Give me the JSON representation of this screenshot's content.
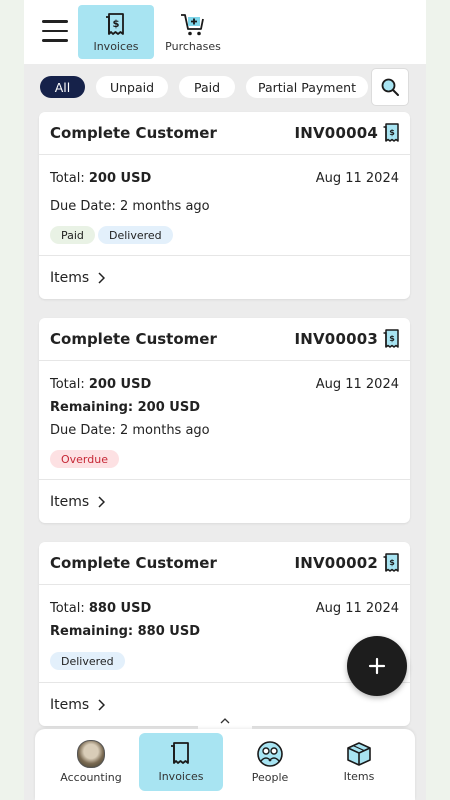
{
  "header": {
    "tabs": [
      {
        "label": "Invoices",
        "icon": "invoice-icon",
        "active": true
      },
      {
        "label": "Purchases",
        "icon": "cart-add-icon",
        "active": false
      }
    ]
  },
  "filters": {
    "chips": [
      "All",
      "Unpaid",
      "Paid",
      "Partial Payment"
    ],
    "active": "All",
    "search_icon": "search-icon"
  },
  "invoices": [
    {
      "customer": "Complete Customer",
      "number": "INV00004",
      "total_label": "Total:",
      "total": "200 USD",
      "date": "Aug 11 2024",
      "due": "Due Date: 2 months ago",
      "tags": [
        "Paid",
        "Delivered"
      ],
      "items_label": "Items"
    },
    {
      "customer": "Complete Customer",
      "number": "INV00003",
      "total_label": "Total:",
      "total": "200 USD",
      "date": "Aug 11 2024",
      "remaining_label": "Remaining:",
      "remaining": "200 USD",
      "due": "Due Date: 2 months ago",
      "tags": [
        "Overdue"
      ],
      "items_label": "Items"
    },
    {
      "customer": "Complete Customer",
      "number": "INV00002",
      "total_label": "Total:",
      "total": "880 USD",
      "date": "Aug 11 2024",
      "remaining_label": "Remaining:",
      "remaining": "880 USD",
      "tags": [
        "Delivered"
      ],
      "items_label": "Items"
    }
  ],
  "fab": {
    "icon": "plus-icon"
  },
  "bottom_nav": [
    {
      "label": "Accounting",
      "icon": "avatar"
    },
    {
      "label": "Invoices",
      "icon": "invoice-icon",
      "active": true
    },
    {
      "label": "People",
      "icon": "people-icon"
    },
    {
      "label": "Items",
      "icon": "box-icon"
    }
  ],
  "colors": {
    "accent": "#a8e4f2",
    "chip_active": "#16224a",
    "overdue_text": "#c62836",
    "overdue_bg": "#fde1e3",
    "paid_bg": "#e9f2e5",
    "delivered_bg": "#e3f0fb",
    "icon_cyan": "#1aa3c7"
  }
}
